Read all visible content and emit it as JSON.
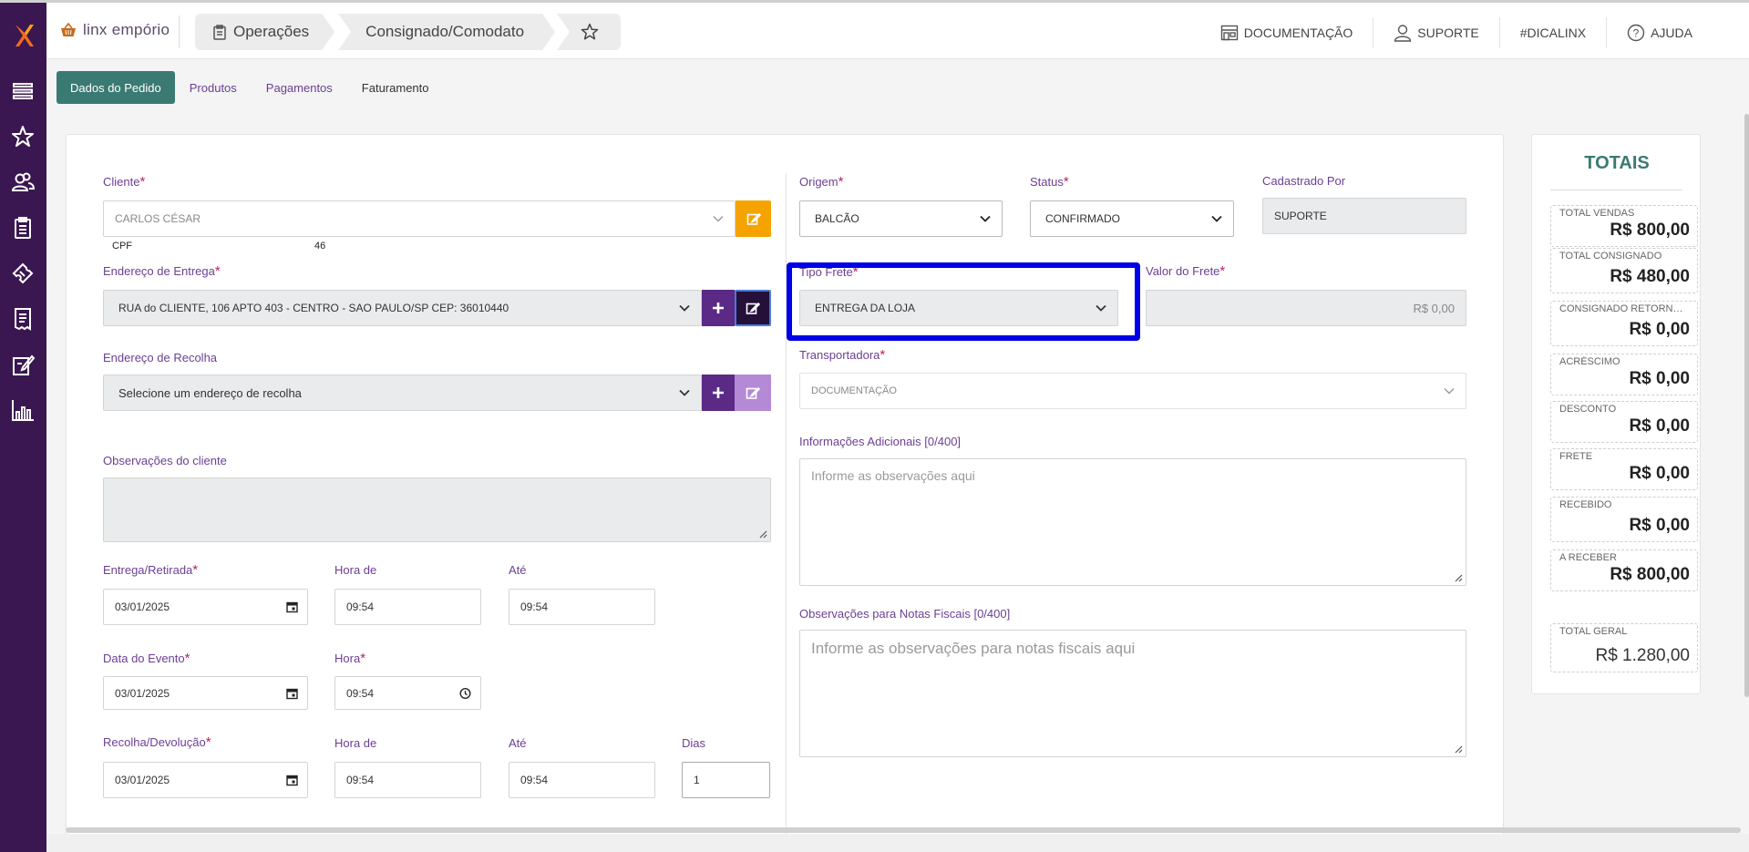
{
  "app": {
    "brand": "linx empório"
  },
  "breadcrumbs": [
    {
      "label": "Operações"
    },
    {
      "label": "Consignado/Comodato"
    }
  ],
  "header_links": [
    {
      "label": "DOCUMENTAÇÃO"
    },
    {
      "label": "SUPORTE"
    },
    {
      "label": "#DICALINX"
    },
    {
      "label": "AJUDA"
    }
  ],
  "tabs": [
    {
      "label": "Dados do Pedido"
    },
    {
      "label": "Produtos"
    },
    {
      "label": "Pagamentos"
    },
    {
      "label": "Faturamento"
    }
  ],
  "form": {
    "cliente": {
      "label": "Cliente",
      "value": "CARLOS CÉSAR",
      "cpf_label": "CPF",
      "cpf_value": "46"
    },
    "endereco_entrega": {
      "label": "Endereço de Entrega",
      "value": "RUA do CLIENTE, 106 APTO 403 - CENTRO - SAO PAULO/SP CEP: 36010440"
    },
    "endereco_recolha": {
      "label": "Endereço de Recolha",
      "placeholder": "Selecione um endereço de recolha"
    },
    "observacoes_cliente": {
      "label": "Observações do cliente"
    },
    "entrega": {
      "label": "Entrega/Retirada",
      "date": "03/01/2025",
      "hora_de_label": "Hora de",
      "hora_de": "09:54",
      "ate_label": "Até",
      "ate": "09:54"
    },
    "evento": {
      "label": "Data do Evento",
      "date": "03/01/2025",
      "hora_label": "Hora",
      "hora": "09:54"
    },
    "recolha": {
      "label": "Recolha/Devolução",
      "date": "03/01/2025",
      "hora_de_label": "Hora de",
      "hora_de": "09:54",
      "ate_label": "Até",
      "ate": "09:54",
      "dias_label": "Dias",
      "dias": "1"
    },
    "origem": {
      "label": "Origem",
      "value": "BALCÃO"
    },
    "status": {
      "label": "Status",
      "value": "CONFIRMADO"
    },
    "cadastrado_por": {
      "label": "Cadastrado Por",
      "value": "SUPORTE"
    },
    "tipo_frete": {
      "label": "Tipo Frete",
      "value": "ENTREGA DA LOJA"
    },
    "valor_frete": {
      "label": "Valor do Frete",
      "value": "R$ 0,00"
    },
    "transportadora": {
      "label": "Transportadora",
      "value": "DOCUMENTAÇÃO"
    },
    "info_adicionais": {
      "label": "Informações Adicionais [0/400]",
      "placeholder": "Informe as observações aqui"
    },
    "obs_notas": {
      "label": "Observações para Notas Fiscais [0/400]",
      "placeholder": "Informe as observações para notas fiscais aqui"
    }
  },
  "totals": {
    "title": "TOTAIS",
    "items": [
      {
        "label": "TOTAL VENDAS",
        "value": "R$ 800,00"
      },
      {
        "label": "TOTAL CONSIGNADO",
        "value": "R$ 480,00"
      },
      {
        "label": "CONSIGNADO RETORNADO",
        "value": "R$ 0,00"
      },
      {
        "label": "ACRÉSCIMO",
        "value": "R$ 0,00"
      },
      {
        "label": "DESCONTO",
        "value": "R$ 0,00"
      },
      {
        "label": "FRETE",
        "value": "R$ 0,00"
      },
      {
        "label": "RECEBIDO",
        "value": "R$ 0,00"
      },
      {
        "label": "A RECEBER",
        "value": "R$ 800,00"
      }
    ],
    "grand": {
      "label": "TOTAL GERAL",
      "value": "R$ 1.280,00"
    }
  },
  "colors": {
    "sidebar": "#3a1750",
    "accent_purple": "#5b2a86",
    "tab_active": "#3b7a73",
    "edit_orange": "#f5a300",
    "highlight": "#0000e6"
  }
}
